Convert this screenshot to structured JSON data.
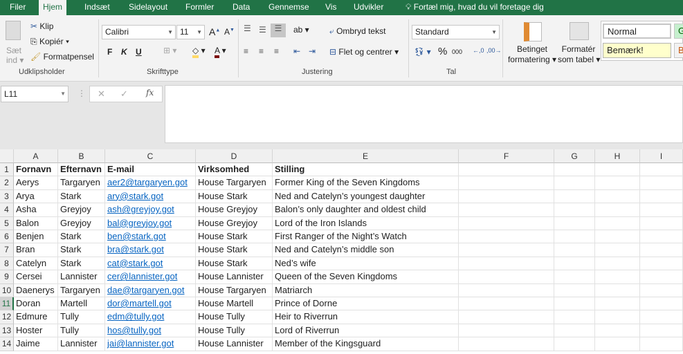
{
  "tabs": [
    "Filer",
    "Hjem",
    "Indsæt",
    "Sidelayout",
    "Formler",
    "Data",
    "Gennemse",
    "Vis",
    "Udvikler"
  ],
  "tell_me": "Fortæl mig, hvad du vil foretage dig",
  "clipboard": {
    "paste": "Sæt",
    "paste2": "ind",
    "cut": "Klip",
    "copy": "Kopiér",
    "format_painter": "Formatpensel",
    "label": "Udklipsholder"
  },
  "font": {
    "name": "Calibri",
    "size": "11",
    "bold": "F",
    "italic": "K",
    "underline": "U",
    "label": "Skrifttype"
  },
  "alignment": {
    "wrap": "Ombryd tekst",
    "merge": "Flet og centrer",
    "label": "Justering"
  },
  "number": {
    "format": "Standard",
    "percent": "%",
    "thousands": "000",
    "label": "Tal"
  },
  "styles": {
    "conditional": "Betinget",
    "conditional2": "formatering",
    "as_table": "Formatér",
    "as_table2": "som tabel",
    "normal": "Normal",
    "note": "Bemærk!",
    "g": "G",
    "b": "B"
  },
  "name_box": "L11",
  "fx": "fx",
  "columns": [
    "A",
    "B",
    "C",
    "D",
    "E",
    "F",
    "G",
    "H",
    "I"
  ],
  "rows": [
    [
      "Fornavn",
      "Efternavn",
      "E-mail",
      "Virksomhed",
      "Stilling"
    ],
    [
      "Aerys",
      "Targaryen",
      "aer2@targaryen.got",
      "House Targaryen",
      "Former King of the Seven Kingdoms"
    ],
    [
      "Arya",
      "Stark",
      "ary@stark.got",
      "House Stark",
      "Ned and Catelyn’s youngest daughter"
    ],
    [
      "Asha",
      "Greyjoy",
      "ash@greyjoy.got",
      "House Greyjoy",
      "Balon’s only daughter and oldest child"
    ],
    [
      "Balon",
      "Greyjoy",
      "bal@greyjoy.got",
      "House Greyjoy",
      "Lord of the Iron Islands"
    ],
    [
      "Benjen",
      "Stark",
      "ben@stark.got",
      "House Stark",
      "First Ranger of the Night’s Watch"
    ],
    [
      "Bran",
      "Stark",
      "bra@stark.got",
      "House Stark",
      "Ned and Catelyn’s middle son"
    ],
    [
      "Catelyn",
      "Stark",
      "cat@stark.got",
      "House Stark",
      "Ned’s wife"
    ],
    [
      "Cersei",
      "Lannister",
      "cer@lannister.got",
      "House Lannister",
      "Queen of the Seven Kingdoms"
    ],
    [
      "Daenerys",
      "Targaryen",
      "dae@targaryen.got",
      "House Targaryen",
      "Matriarch"
    ],
    [
      "Doran",
      "Martell",
      "dor@martell.got",
      "House Martell",
      "Prince of Dorne"
    ],
    [
      "Edmure",
      "Tully",
      "edm@tully.got",
      "House Tully",
      "Heir to Riverrun"
    ],
    [
      "Hoster",
      "Tully",
      "hos@tully.got",
      "House Tully",
      "Lord of Riverrun"
    ],
    [
      "Jaime",
      "Lannister",
      "jai@lannister.got",
      "House Lannister",
      "Member of the Kingsguard"
    ]
  ],
  "row_numbers": [
    "1",
    "2",
    "3",
    "4",
    "5",
    "6",
    "7",
    "8",
    "9",
    "10",
    "11",
    "12",
    "13",
    "14"
  ],
  "selected_row": "11"
}
